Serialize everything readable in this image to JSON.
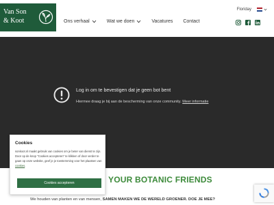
{
  "header": {
    "logo": {
      "line1": "Van Son",
      "line2": "& Koot"
    },
    "nav": [
      {
        "label": "Ons verhaal",
        "dropdown": true
      },
      {
        "label": "Wat we doen",
        "dropdown": true
      },
      {
        "label": "Vacatures",
        "dropdown": false
      },
      {
        "label": "Contact",
        "dropdown": false
      }
    ],
    "floriday_label": "Floriday",
    "language": "NL",
    "socials": [
      "instagram-icon",
      "facebook-icon",
      "linkedin-icon"
    ]
  },
  "overlay": {
    "title": "Log in om te bevestigen dat je geen bot bent",
    "subtitle": "Hiermee draag je bij aan de bescherming van onze community.",
    "link": "Meer informatie"
  },
  "main": {
    "tagline": "YOUR BOTANIC FRIENDS",
    "intro_text": "We houden van planten en van mensen,",
    "intro_bold": "SAMEN MAKEN WE DE WERELD GROENER. DOE JE MEE?"
  },
  "cookie_banner": {
    "title": "Cookies",
    "body": "sonkoot.nl maakt gebruik van cookies om je beter van dienst te zijn. Door op de knop \"Cookies accepteren\" te klikken of door verder te gaan op onze website, geef je je toestemming voor het plaatsen van",
    "link": "cookies",
    "button": "Cookies accepteren"
  },
  "colors": {
    "brand_green": "#1f5b3a",
    "accent_green": "#3c8a3a",
    "overlay_bg": "#2a2a2a"
  }
}
